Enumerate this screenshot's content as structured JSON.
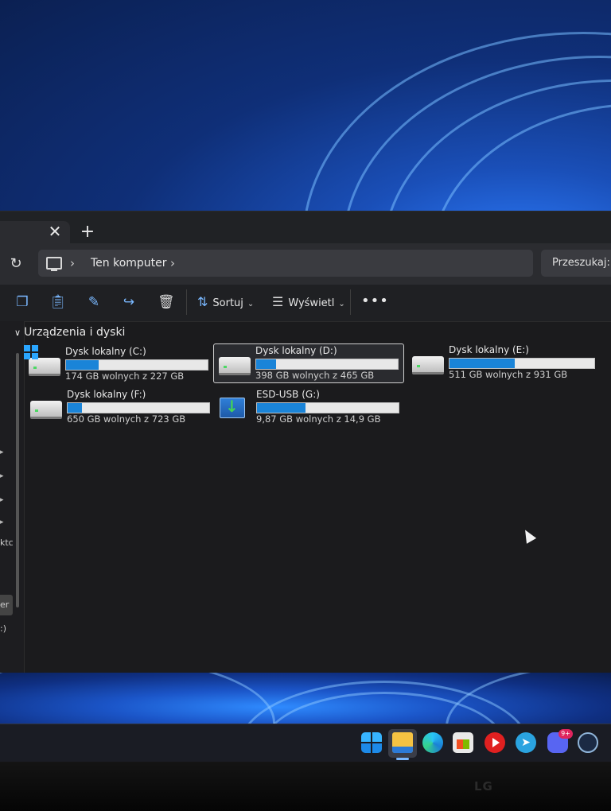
{
  "explorer": {
    "tab": {
      "close_glyph": "✕",
      "new_tab_glyph": "+"
    },
    "address": {
      "breadcrumb": "Ten komputer",
      "separator": "›"
    },
    "search": {
      "label": "Przeszukaj: T"
    },
    "toolbar": {
      "sort_label": "Sortuj",
      "view_label": "Wyświetl",
      "more_glyph": "•••",
      "icons": [
        "copy-icon",
        "paste-icon",
        "rename-icon",
        "share-icon",
        "delete-icon",
        "sort-icon",
        "view-icon"
      ]
    },
    "sidebar": {
      "partial_items": [
        "ktc",
        "er",
        ":)"
      ]
    },
    "group": {
      "title": "Urządzenia i dyski"
    },
    "drives": [
      {
        "name": "Dysk lokalny (C:)",
        "free": "174 GB wolnych z 227 GB",
        "used_fraction": 0.23,
        "icon": "windows-drive-icon",
        "selected": false
      },
      {
        "name": "Dysk lokalny (D:)",
        "free": "398 GB wolnych z 465 GB",
        "used_fraction": 0.14,
        "icon": "hard-drive-icon",
        "selected": true
      },
      {
        "name": "Dysk lokalny (E:)",
        "free": "511 GB wolnych z 931 GB",
        "used_fraction": 0.45,
        "icon": "hard-drive-icon",
        "selected": false
      },
      {
        "name": "Dysk lokalny (F:)",
        "free": "650 GB wolnych z 723 GB",
        "used_fraction": 0.1,
        "icon": "hard-drive-icon",
        "selected": false
      },
      {
        "name": "ESD-USB (G:)",
        "free": "9,87 GB wolnych z 14,9 GB",
        "used_fraction": 0.34,
        "icon": "usb-drive-icon",
        "selected": false
      }
    ],
    "colors": {
      "accent": "#1a84d8",
      "background": "#1b1b1d"
    }
  },
  "taskbar": {
    "apps": [
      "start-icon",
      "file-explorer-icon",
      "edge-icon",
      "store-icon",
      "youtube-music-icon",
      "telegram-icon",
      "discord-icon",
      "steam-icon"
    ],
    "discord_badge": "9+",
    "telegram_glyph": "➤"
  },
  "monitor": {
    "brand": "LG"
  }
}
